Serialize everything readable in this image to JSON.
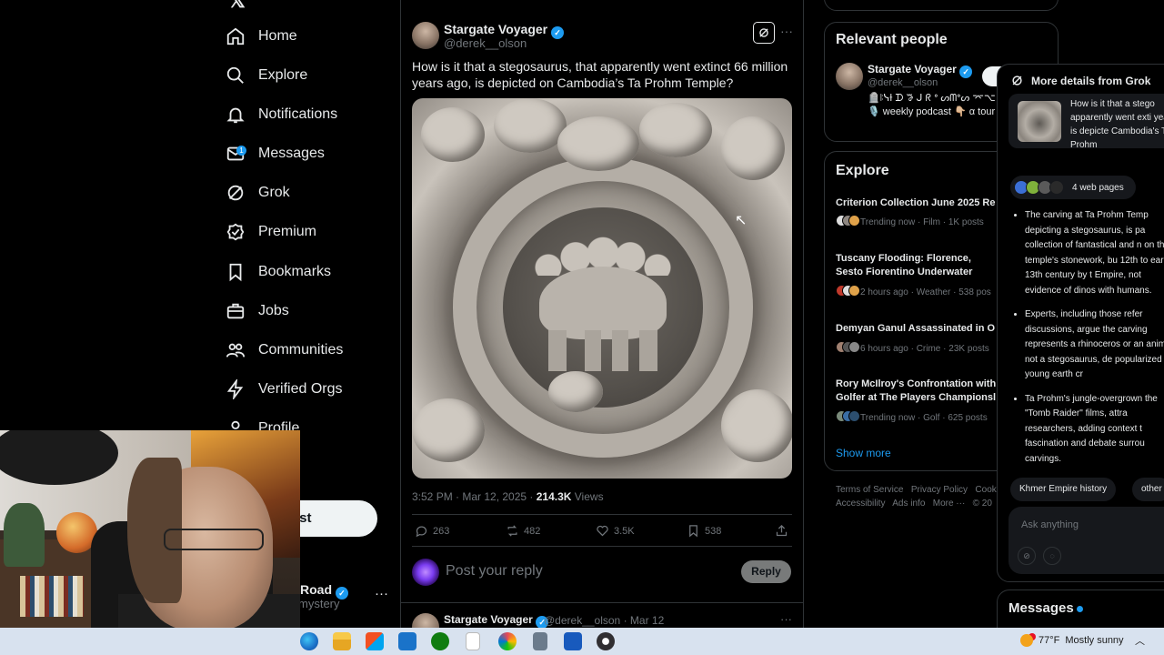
{
  "nav": {
    "items": [
      {
        "label": "Home",
        "icon": "home-icon"
      },
      {
        "label": "Explore",
        "icon": "search-icon"
      },
      {
        "label": "Notifications",
        "icon": "bell-icon"
      },
      {
        "label": "Messages",
        "icon": "envelope-icon",
        "badge": "1"
      },
      {
        "label": "Grok",
        "icon": "grok-icon"
      },
      {
        "label": "Premium",
        "icon": "premium-icon"
      },
      {
        "label": "Bookmarks",
        "icon": "bookmark-icon"
      },
      {
        "label": "Jobs",
        "icon": "briefcase-icon"
      },
      {
        "label": "Communities",
        "icon": "communities-icon"
      },
      {
        "label": "Verified Orgs",
        "icon": "lightning-icon"
      },
      {
        "label": "Profile",
        "icon": "person-icon"
      }
    ],
    "post_label": "ost",
    "account_name": "Road",
    "account_handle": "mystery"
  },
  "tweet": {
    "author_name": "Stargate Voyager",
    "author_handle": "@derek__olson",
    "text": "How is it that a stegosaurus, that apparently went extinct 66 million years ago, is depicted on Cambodia’s Ta Prohm Temple?",
    "time": "3:52 PM · Mar 12, 2025 · ",
    "views_count": "214.3K",
    "views_label": " Views",
    "replies": "263",
    "reposts": "482",
    "likes": "3.5K",
    "bookmarks": "538"
  },
  "reply_box": {
    "placeholder": "Post your reply",
    "button": "Reply"
  },
  "next_reply": {
    "name": "Stargate Voyager",
    "meta": "@derek__olson · Mar 12"
  },
  "relevant_people": {
    "title": "Relevant people",
    "name": "Stargate Voyager",
    "handle": "@derek__olson",
    "bio": "🪦ꖎᓭƗ ᗪ ꖃ ᒍ ᖇ ᐤ ᔕᗰᐤᔕ ⌤⌥ 🎙️ weekly podcast 👇🏼 α tour",
    "follow": "F"
  },
  "explore": {
    "title": "Explore",
    "trends": [
      {
        "title": "Criterion Collection June 2025 Re",
        "meta": "Trending now · Film · 1K posts"
      },
      {
        "title": "Tuscany Flooding: Florence, Sesto Fiorentino Underwater",
        "meta": "2 hours ago · Weather · 538 pos"
      },
      {
        "title": "Demyan Ganul Assassinated in O",
        "meta": "6 hours ago · Crime · 23K posts"
      },
      {
        "title": "Rory McIlroy's Confrontation with Golfer at The Players Championsl",
        "meta": "Trending now · Golf · 625 posts"
      }
    ],
    "show_more": "Show more"
  },
  "footer": {
    "links": [
      "Terms of Service",
      "Privacy Policy",
      "Cooki",
      "Accessibility",
      "Ads info",
      "More ···",
      "© 20"
    ]
  },
  "grok": {
    "title": "More details from Grok",
    "question": "How is it that a stego apparently went exti years ago, is depicte Cambodia's Ta Prohm",
    "web_pages": "4 web pages",
    "bullets": [
      "The carving at Ta Prohm Temp depicting a stegosaurus, is pa collection of fantastical and n on the temple's stonework, bu 12th to early 13th century by t Empire, not evidence of dinos with humans.",
      "Experts, including those refer discussions, argue the carving represents a rhinoceros or an animal, not a stegosaurus, de popularized by young earth cr",
      "Ta Prohm's jungle-overgrown the \"Tomb Raider\" films, attra researchers, adding context t fascination and debate surrou carvings."
    ],
    "chips": [
      "Khmer Empire history",
      "other"
    ],
    "ask_placeholder": "Ask anything"
  },
  "messages_drawer": {
    "title": "Messages"
  },
  "taskbar": {
    "weather_temp": "77°F",
    "weather_text": "Mostly sunny",
    "icons": [
      "edge-icon",
      "folder-icon",
      "store-icon",
      "mail-icon",
      "xbox-icon",
      "notepad-icon",
      "paint-icon",
      "calculator-icon",
      "word-icon",
      "obs-icon"
    ]
  },
  "colors": {
    "accent": "#1d9bf0",
    "background": "#000000",
    "text": "#e7e9ea",
    "muted": "#71767b",
    "border": "#2f3336"
  }
}
